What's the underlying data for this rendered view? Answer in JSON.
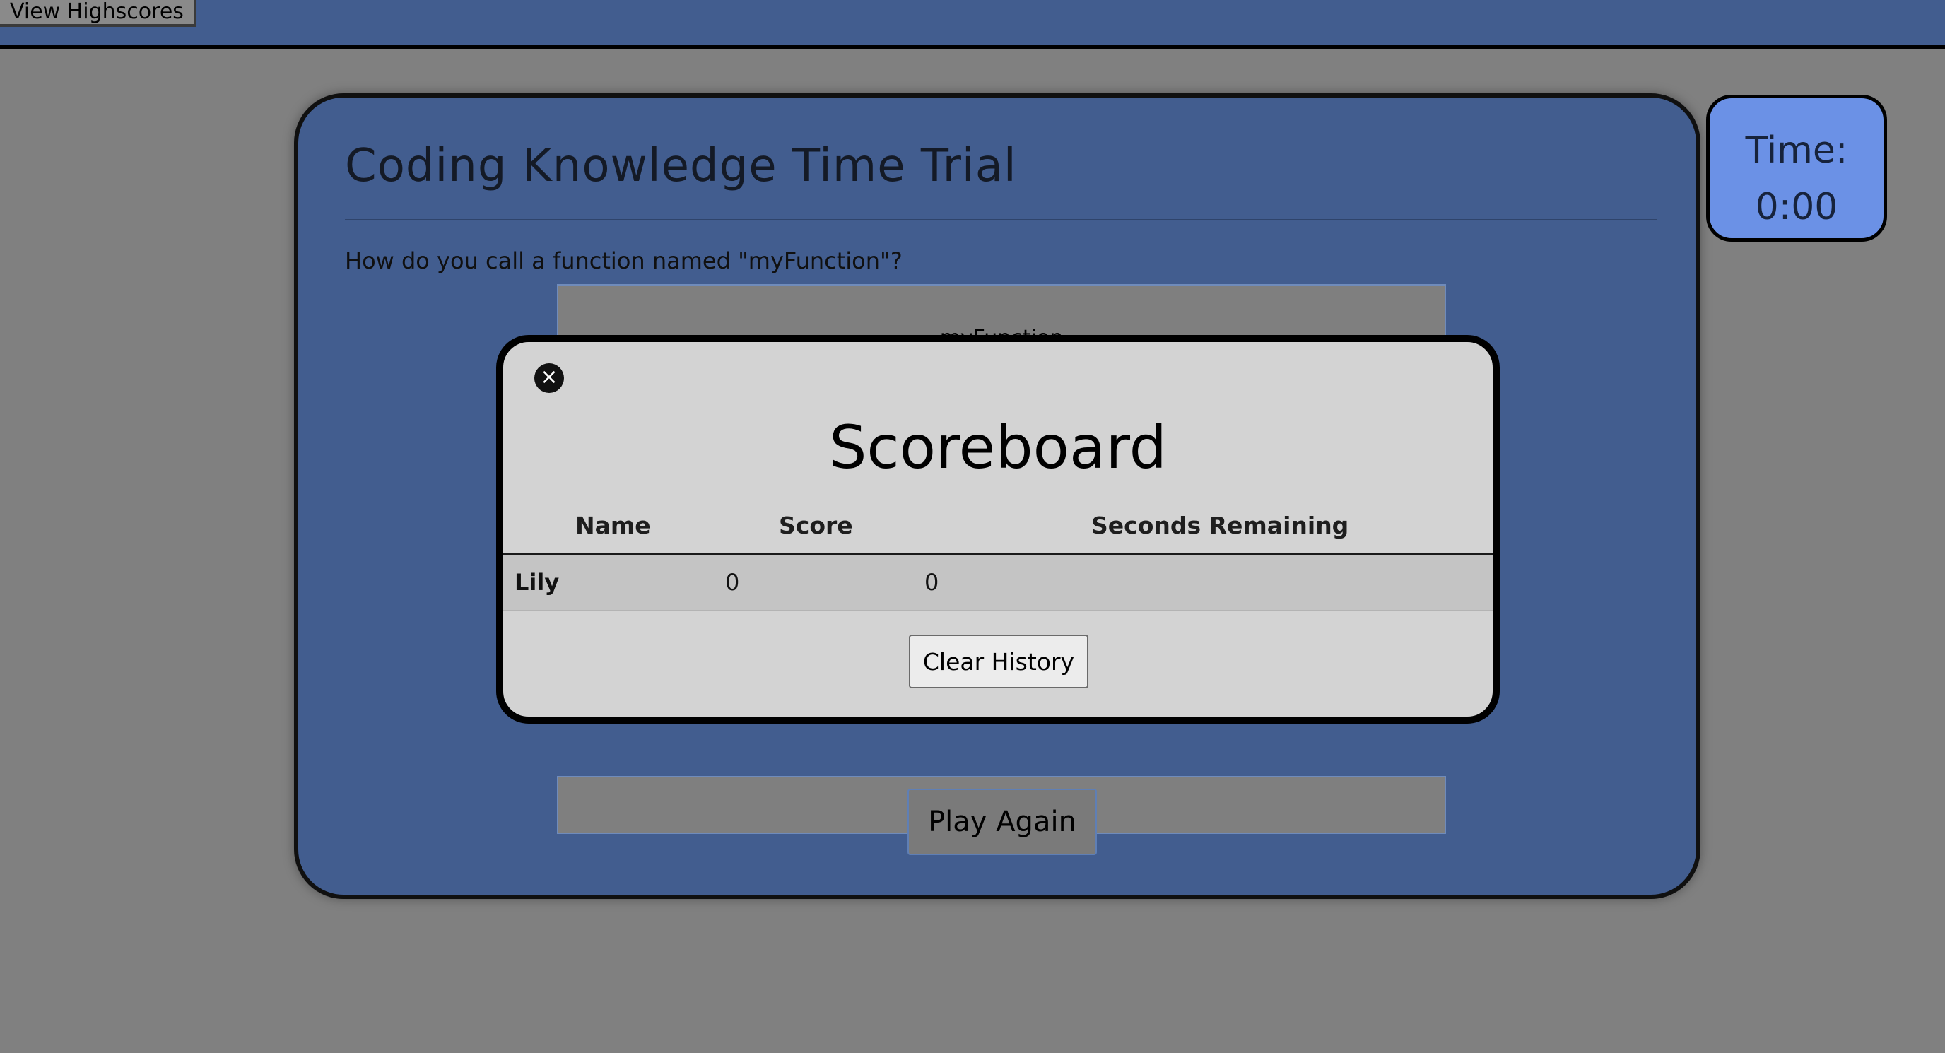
{
  "topbar": {
    "view_highscores_label": "View Highscores"
  },
  "quiz": {
    "title": "Coding Knowledge Time Trial",
    "question": "How do you call a function named \"myFunction\"?",
    "answers": [
      "myFunction",
      ""
    ],
    "play_again_label": "Play Again"
  },
  "timer": {
    "label": "Time:",
    "value": "0:00"
  },
  "scoreboard": {
    "close_icon": "×",
    "title": "Scoreboard",
    "columns": [
      "Name",
      "Score",
      "Seconds Remaining"
    ],
    "rows": [
      {
        "name": "Lily",
        "score": "0",
        "seconds_remaining": "0"
      }
    ],
    "clear_label": "Clear History"
  },
  "colors": {
    "page_background": "#808080",
    "card_background": "#425d8f",
    "timer_background": "#6b91e6",
    "modal_background": "#d3d3d3"
  }
}
